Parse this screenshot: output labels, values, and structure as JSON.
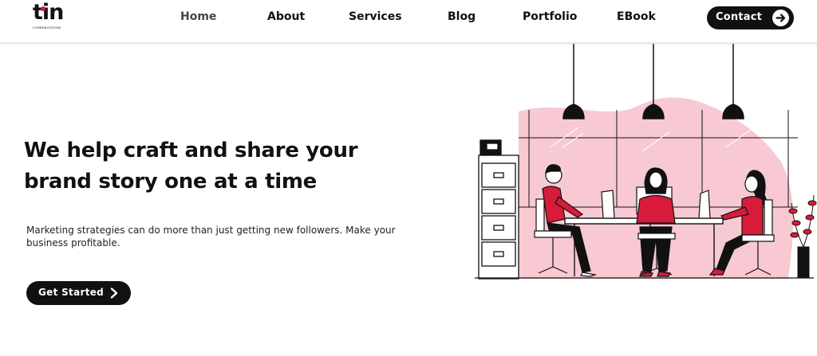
{
  "brand": {
    "logo_text": "tin",
    "logo_subtext": "COMMUNICATIONS",
    "accent_color": "#d81b3a"
  },
  "nav": {
    "items": [
      {
        "label": "Home",
        "active": true
      },
      {
        "label": "About",
        "active": false
      },
      {
        "label": "Services",
        "active": false
      },
      {
        "label": "Blog",
        "active": false
      },
      {
        "label": "Portfolio",
        "active": false
      },
      {
        "label": "EBook",
        "active": false
      }
    ],
    "contact_label": "Contact",
    "contact_icon": "arrow-right-circle-icon"
  },
  "hero": {
    "title_line1": "We help craft and share your",
    "title_line2": "brand story one at a time",
    "description": "Marketing strategies can do more than just getting new followers. Make your business profitable.",
    "cta_label": "Get Started",
    "cta_icon": "chevron-right-icon"
  },
  "illustration": {
    "subject": "office-team-at-desk-illustration",
    "colors": {
      "blob": "#f8c9d2",
      "clothing": "#d81b3a",
      "line": "#111111"
    }
  }
}
